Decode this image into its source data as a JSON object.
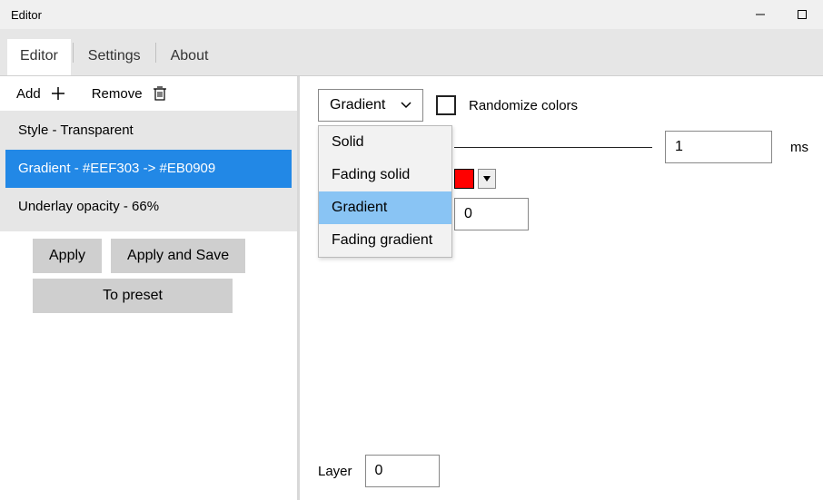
{
  "window": {
    "title": "Editor"
  },
  "tabs": {
    "items": [
      "Editor",
      "Settings",
      "About"
    ],
    "active": 0
  },
  "toolbar": {
    "add_label": "Add",
    "remove_label": "Remove"
  },
  "list": {
    "items": [
      "Style - Transparent",
      "Gradient - #EEF303 -> #EB0909",
      "Underlay opacity - 66%"
    ],
    "selected": 1
  },
  "buttons": {
    "apply": "Apply",
    "apply_save": "Apply and Save",
    "to_preset": "To preset"
  },
  "right": {
    "select_value": "Gradient",
    "dropdown_options": [
      "Solid",
      "Fading solid",
      "Gradient",
      "Fading gradient"
    ],
    "dropdown_highlight": 2,
    "randomize_label": "Randomize colors",
    "randomize_checked": false,
    "ms_value": "1",
    "ms_unit": "ms",
    "color_swatch": "#ff0000",
    "num_value": "0",
    "layer_label": "Layer",
    "layer_value": "0"
  }
}
